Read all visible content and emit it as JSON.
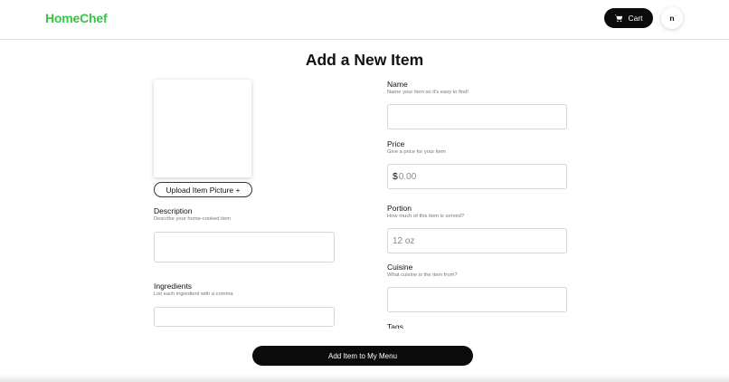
{
  "header": {
    "logo": "HomeChef",
    "cart_label": "Cart",
    "cart_icon": "cart-icon",
    "avatar_initial": "n"
  },
  "page": {
    "title": "Add a New Item",
    "upload_label": "Upload Item Picture +",
    "submit_label": "Add Item to My Menu"
  },
  "fields": {
    "name": {
      "label": "Name",
      "help": "Name your item so it's easy to find!",
      "value": "",
      "placeholder": ""
    },
    "price": {
      "label": "Price",
      "help": "Give a price for your item",
      "prefix": "$",
      "value": "",
      "placeholder": "0.00"
    },
    "portion": {
      "label": "Portion",
      "help": "How much of this item is served?",
      "value": "",
      "placeholder": "12 oz"
    },
    "cuisine": {
      "label": "Cuisine",
      "help": "What cuisine is the item from?",
      "value": "",
      "placeholder": ""
    },
    "tags": {
      "label": "Tags"
    },
    "description": {
      "label": "Description",
      "help": "Describe your home-cooked item",
      "value": "",
      "placeholder": ""
    },
    "ingredients": {
      "label": "Ingredients",
      "help": "List each ingredient with a comma",
      "value": "",
      "placeholder": ""
    }
  },
  "colors": {
    "brand": "#3ac24a",
    "button_dark": "#0b0b0b"
  }
}
